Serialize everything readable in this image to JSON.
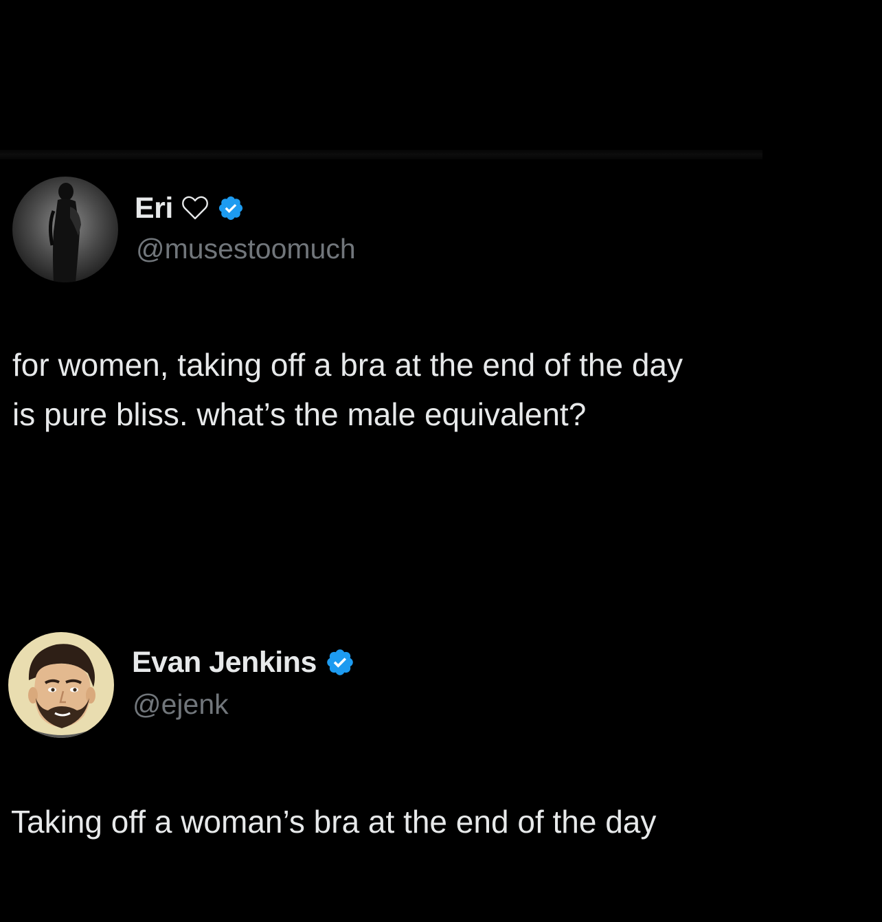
{
  "tweets": [
    {
      "display_name": "Eri",
      "handle": "@musestoomuch",
      "text_lines": [
        "for women, taking off a bra at the end of the day",
        "is pure bliss. what’s the male equivalent?"
      ],
      "verified": true,
      "name_emoji_icon": "heart-outline-icon"
    },
    {
      "display_name": "Evan Jenkins",
      "handle": "@ejenk",
      "text_lines": [
        "Taking off a woman’s bra at the end of the day"
      ],
      "verified": true
    }
  ],
  "colors": {
    "background": "#000000",
    "primary_text": "#e7e9ea",
    "secondary_text": "#71767b",
    "verified_badge": "#1d9bf0"
  }
}
